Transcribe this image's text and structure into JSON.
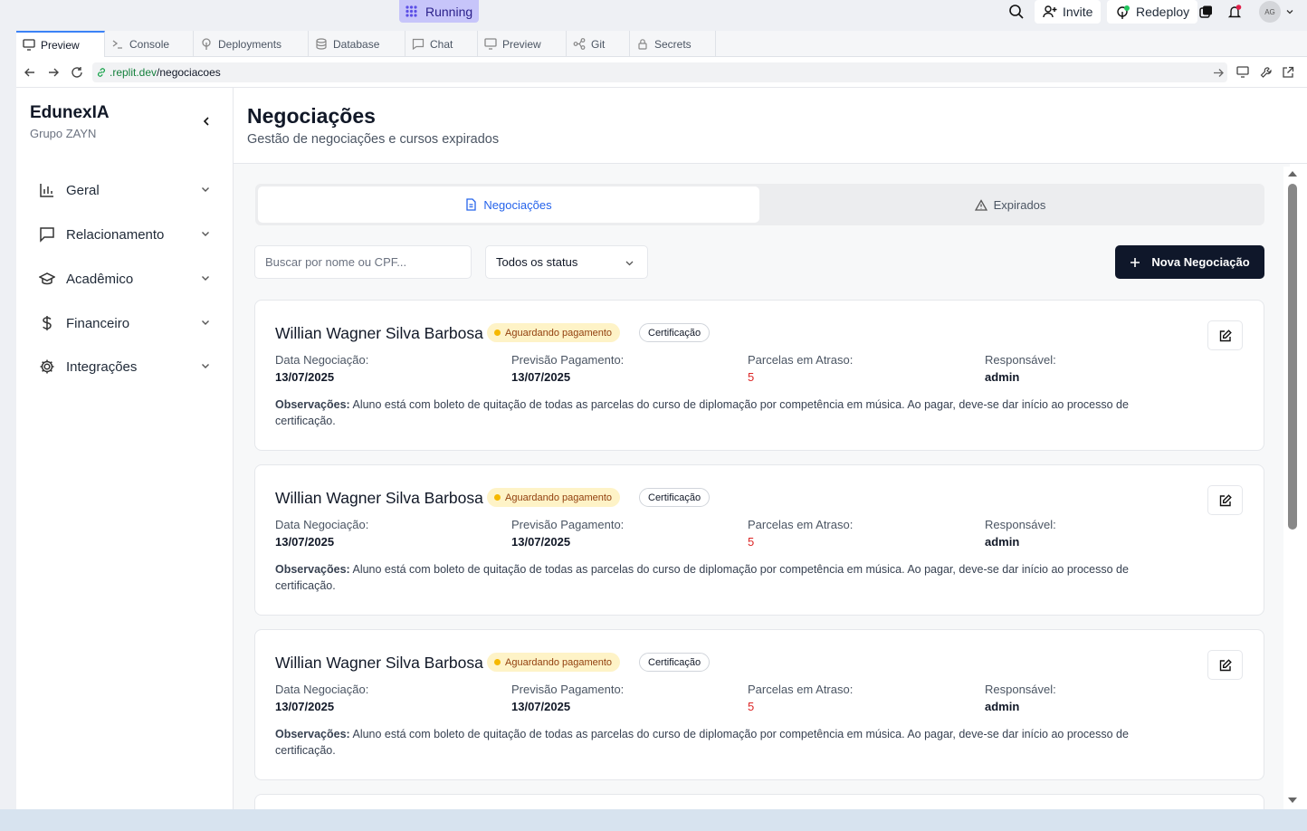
{
  "topbar": {
    "status": "Running",
    "invite": "Invite",
    "redeploy": "Redeploy",
    "avatar": "AG"
  },
  "tabs": [
    {
      "label": "Preview",
      "icon": "monitor-icon"
    },
    {
      "label": "Console",
      "icon": "terminal-icon"
    },
    {
      "label": "Deployments",
      "icon": "deploy-icon"
    },
    {
      "label": "Database",
      "icon": "database-icon"
    },
    {
      "label": "Chat",
      "icon": "chat-icon"
    },
    {
      "label": "Preview",
      "icon": "monitor-icon"
    },
    {
      "label": "Git",
      "icon": "git-icon"
    },
    {
      "label": "Secrets",
      "icon": "lock-icon"
    }
  ],
  "url": {
    "domain": ".replit.dev",
    "path": "/negociacoes"
  },
  "sidebar": {
    "brand": "EdunexIA",
    "subtitle": "Grupo ZAYN",
    "items": [
      {
        "label": "Geral",
        "icon": "bar-chart-icon"
      },
      {
        "label": "Relacionamento",
        "icon": "message-icon"
      },
      {
        "label": "Acadêmico",
        "icon": "graduation-cap-icon"
      },
      {
        "label": "Financeiro",
        "icon": "dollar-icon"
      },
      {
        "label": "Integrações",
        "icon": "gear-icon"
      }
    ]
  },
  "header": {
    "title": "Negociações",
    "subtitle": "Gestão de negociações e cursos expirados"
  },
  "segments": {
    "active": "Negociações",
    "inactive": "Expirados"
  },
  "filters": {
    "search_placeholder": "Buscar por nome ou CPF...",
    "status_select": "Todos os status",
    "new_button": "Nova Negociação"
  },
  "field_labels": {
    "data": "Data Negociação:",
    "previsao": "Previsão Pagamento:",
    "parcelas": "Parcelas em Atraso:",
    "responsavel": "Responsável:",
    "obs": "Observações:"
  },
  "cards": [
    {
      "name": "Willian Wagner Silva Barbosa",
      "status": "Aguardando pagamento",
      "type": "Certificação",
      "data": "13/07/2025",
      "previsao": "13/07/2025",
      "parcelas": "5",
      "responsavel": "admin",
      "obs": "Aluno está com boleto de quitação de todas as parcelas do curso de diplomação por competência em música. Ao pagar, deve-se dar início ao processo de certificação."
    },
    {
      "name": "Willian Wagner Silva Barbosa",
      "status": "Aguardando pagamento",
      "type": "Certificação",
      "data": "13/07/2025",
      "previsao": "13/07/2025",
      "parcelas": "5",
      "responsavel": "admin",
      "obs": "Aluno está com boleto de quitação de todas as parcelas do curso de diplomação por competência em música. Ao pagar, deve-se dar início ao processo de certificação."
    },
    {
      "name": "Willian Wagner Silva Barbosa",
      "status": "Aguardando pagamento",
      "type": "Certificação",
      "data": "13/07/2025",
      "previsao": "13/07/2025",
      "parcelas": "5",
      "responsavel": "admin",
      "obs": "Aluno está com boleto de quitação de todas as parcelas do curso de diplomação por competência em música. Ao pagar, deve-se dar início ao processo de certificação."
    }
  ],
  "colors": {
    "primary": "#0f172a",
    "accent": "#2563eb",
    "danger": "#dc2626",
    "pending_bg": "#fef3c7"
  }
}
